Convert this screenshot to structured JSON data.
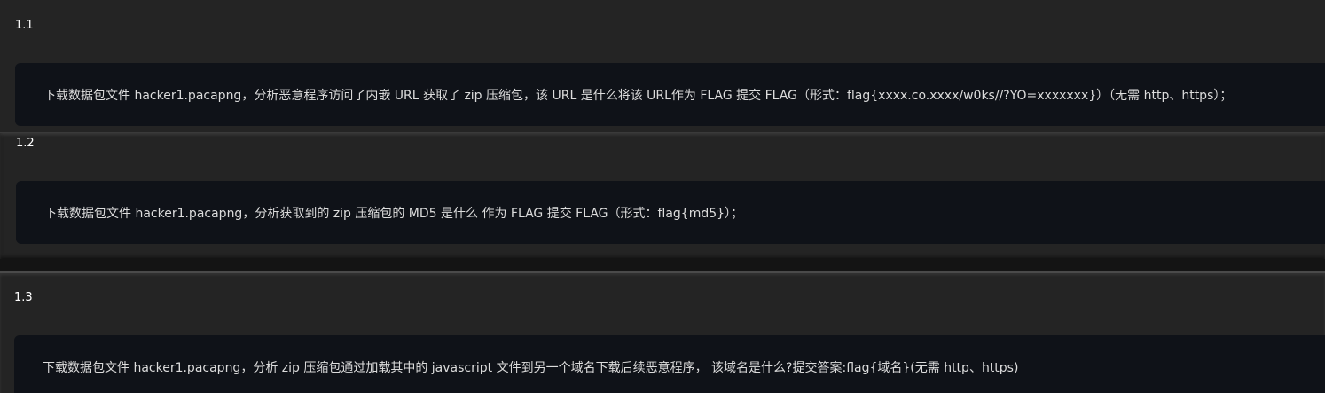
{
  "questions": [
    {
      "number": "1.1",
      "text": "下载数据包文件 hacker1.pacapng，分析恶意程序访问了内嵌 URL 获取了 zip 压缩包，该 URL 是什么将该 URL作为 FLAG 提交 FLAG（形式：flag{xxxx.co.xxxx/w0ks//?YO=xxxxxxx}）（无需 http、https）；"
    },
    {
      "number": "1.2",
      "text": "下载数据包文件 hacker1.pacapng，分析获取到的 zip 压缩包的 MD5 是什么 作为 FLAG 提交 FLAG（形式：flag{md5}）；"
    },
    {
      "number": "1.3",
      "text": "下载数据包文件 hacker1.pacapng，分析 zip 压缩包通过加载其中的 javascript 文件到另一个域名下载后续恶意程序， 该域名是什么?提交答案:flag{域名}(无需 http、https)"
    }
  ]
}
